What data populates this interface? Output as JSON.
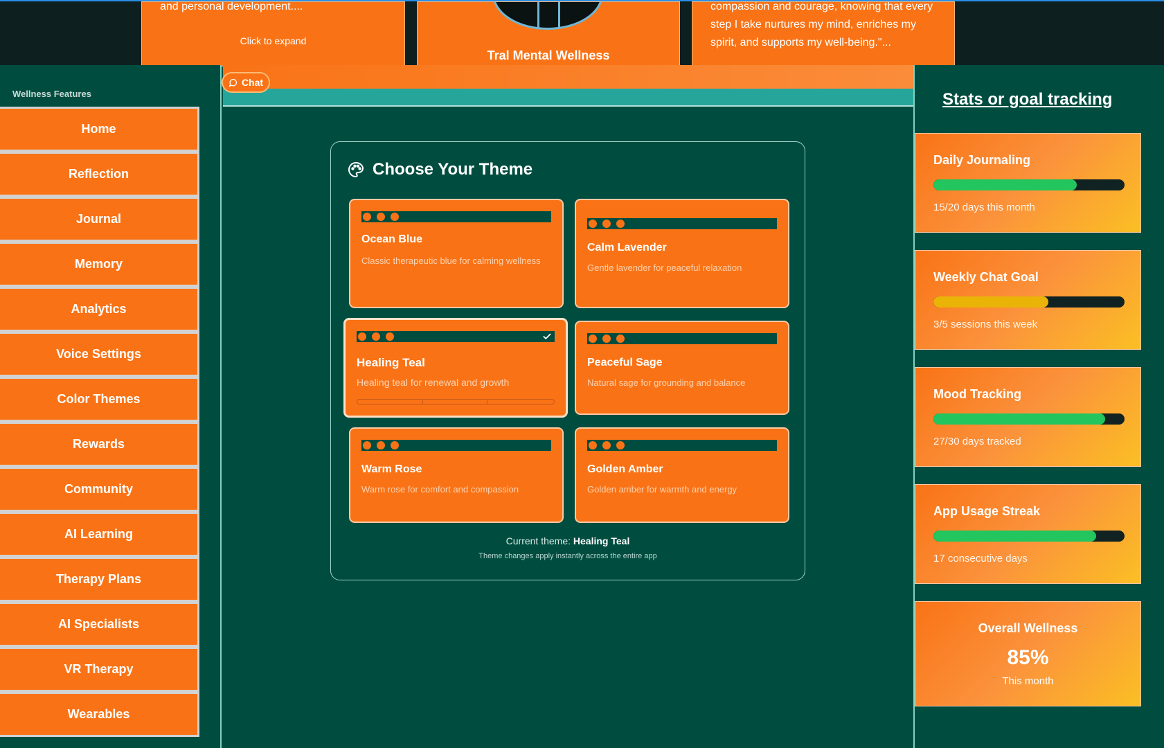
{
  "top_cards": {
    "left_snippet": "and personal development....",
    "left_expand": "Click to expand",
    "brand": "Tral Mental Wellness",
    "right_quote": "compassion and courage, knowing that every step I take nurtures my mind, enriches my spirit, and supports my well-being.\"..."
  },
  "sidebar": {
    "title": "Wellness Features",
    "items": [
      {
        "label": "Home"
      },
      {
        "label": "Reflection"
      },
      {
        "label": "Journal"
      },
      {
        "label": "Memory"
      },
      {
        "label": "Analytics"
      },
      {
        "label": "Voice Settings"
      },
      {
        "label": "Color Themes"
      },
      {
        "label": "Rewards"
      },
      {
        "label": "Community"
      },
      {
        "label": "AI Learning"
      },
      {
        "label": "Therapy Plans"
      },
      {
        "label": "AI Specialists"
      },
      {
        "label": "VR Therapy"
      },
      {
        "label": "Wearables"
      }
    ]
  },
  "chat": {
    "label": "Chat"
  },
  "theme_panel": {
    "title": "Choose Your Theme",
    "themes": [
      {
        "name": "Ocean Blue",
        "description": "Classic therapeutic blue for calming wellness"
      },
      {
        "name": "Calm Lavender",
        "description": "Gentle lavender for peaceful relaxation"
      },
      {
        "name": "Healing Teal",
        "description": "Healing teal for renewal and growth",
        "selected": true
      },
      {
        "name": "Peaceful Sage",
        "description": "Natural sage for grounding and balance"
      },
      {
        "name": "Warm Rose",
        "description": "Warm rose for comfort and compassion"
      },
      {
        "name": "Golden Amber",
        "description": "Golden amber for warmth and energy"
      }
    ],
    "current_prefix": "Current theme:",
    "current_theme": "Healing Teal",
    "hint": "Theme changes apply instantly across the entire app"
  },
  "stats": {
    "title": "Stats or goal tracking",
    "cards": [
      {
        "label": "Daily Journaling",
        "detail": "15/20 days this month",
        "progress": 0.75,
        "color": "#22c55e"
      },
      {
        "label": "Weekly Chat Goal",
        "detail": "3/5 sessions this week",
        "progress": 0.6,
        "color": "#eab308"
      },
      {
        "label": "Mood Tracking",
        "detail": "27/30 days tracked",
        "progress": 0.9,
        "color": "#22c55e"
      },
      {
        "label": "App Usage Streak",
        "detail": "17 consecutive days",
        "progress": 0.85,
        "color": "#22c55e"
      }
    ],
    "overall": {
      "label": "Overall Wellness",
      "value": "85%",
      "sub": "This month"
    }
  },
  "colors": {
    "accent": "#f97316",
    "background": "#004d40",
    "teal": "#26a69a"
  }
}
